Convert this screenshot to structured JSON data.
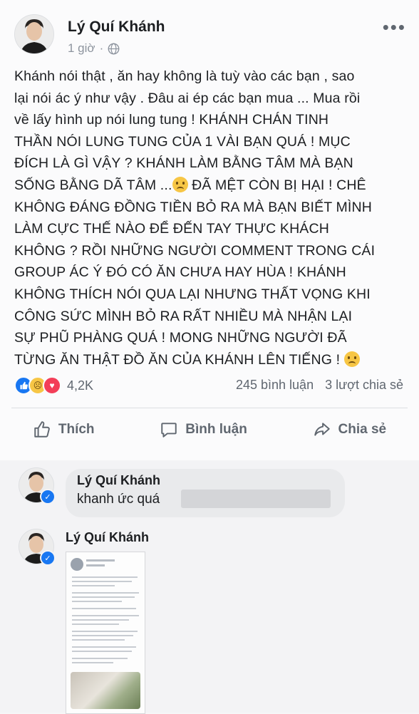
{
  "post": {
    "author": "Lý Quí Khánh",
    "time": "1 giờ",
    "separator": "·",
    "more": "•••",
    "body_lines": [
      "Khánh nói thật , ăn hay không là tuỳ vào các bạn , sao",
      "lại nói ác ý như vậy . Đâu ai ép các bạn mua ... Mua rồi",
      "về lấy hình up nói lung tung ! KHÁNH CHÁN TINH",
      "THẦN NÓI LUNG TUNG CỦA 1 VÀI BẠN QUÁ ! MỤC",
      "ĐÍCH LÀ GÌ VẬY ? KHÁNH LÀM BẰNG TÂM MÀ BẠN",
      "SỐNG BẰNG DÃ TÂM ...",
      " ĐÃ MỆT CÒN BỊ HẠI ! CHÊ",
      "KHÔNG ĐÁNG ĐỒNG TIỀN BỎ RA MÀ BẠN BIẾT MÌNH",
      "LÀM CỰC THẾ NÀO ĐỂ ĐẾN TAY THỰC KHÁCH",
      "KHÔNG ? RỒI NHỮNG NGƯỜI COMMENT TRONG CÁI",
      "GROUP ÁC Ý ĐÓ CÓ ĂN CHƯA HAY HÙA ! KHÁNH",
      "KHÔNG THÍCH NÓI QUA LẠI NHƯNG THẤT VỌNG KHI",
      "CÔNG SỨC MÌNH BỎ RA RẤT NHIỀU MÀ NHẬN LẠI",
      "SỰ PHŨ PHÀNG QUÁ ! MONG NHỮNG NGƯỜI ĐÃ",
      "TỪNG ĂN THẬT ĐỒ ĂN CỦA KHÁNH LÊN TIẾNG !"
    ],
    "reaction_count": "4,2K",
    "comment_count": "245 bình luận",
    "share_count": "3 lượt chia sẻ",
    "icons": {
      "globe": "globe-icon",
      "sad": "sad-face-emoji"
    }
  },
  "actions": {
    "like": "Thích",
    "comment": "Bình luận",
    "share": "Chia sẻ"
  },
  "comments": [
    {
      "name": "Lý Quí Khánh",
      "text": "khanh ức quá"
    },
    {
      "name": "Lý Quí Khánh"
    }
  ],
  "colors": {
    "accent": "#1877f2",
    "love": "#f33e58",
    "sad": "#f7c645",
    "secondary_text": "#606770"
  }
}
